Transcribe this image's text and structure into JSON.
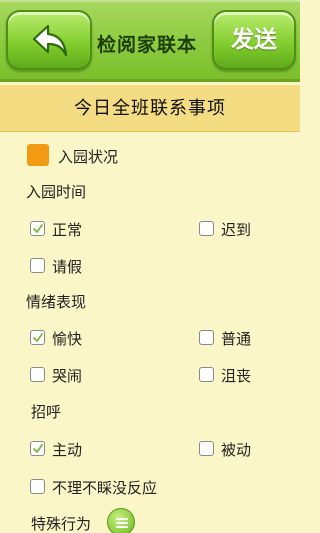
{
  "nav": {
    "back_icon": "back-arrow-icon",
    "title": "检阅家联本",
    "send_label": "发送"
  },
  "header": {
    "title": "今日全班联系事项"
  },
  "arrival_status": {
    "label": "入园状况",
    "color": "#f39a13"
  },
  "arrival_time": {
    "title": "入园时间",
    "options": [
      {
        "label": "正常",
        "checked": true
      },
      {
        "label": "迟到",
        "checked": false
      },
      {
        "label": "请假",
        "checked": false
      }
    ]
  },
  "mood": {
    "title": "情绪表现",
    "options": [
      {
        "label": "愉快",
        "checked": true
      },
      {
        "label": "普通",
        "checked": false
      },
      {
        "label": "哭闹",
        "checked": false
      },
      {
        "label": "沮丧",
        "checked": false
      }
    ]
  },
  "greeting": {
    "title": "招呼",
    "options": [
      {
        "label": "主动",
        "checked": true
      },
      {
        "label": "被动",
        "checked": false
      },
      {
        "label": "不理不睬没反应",
        "checked": false
      }
    ]
  },
  "special": {
    "title": "特殊行为",
    "icon": "menu-icon"
  }
}
